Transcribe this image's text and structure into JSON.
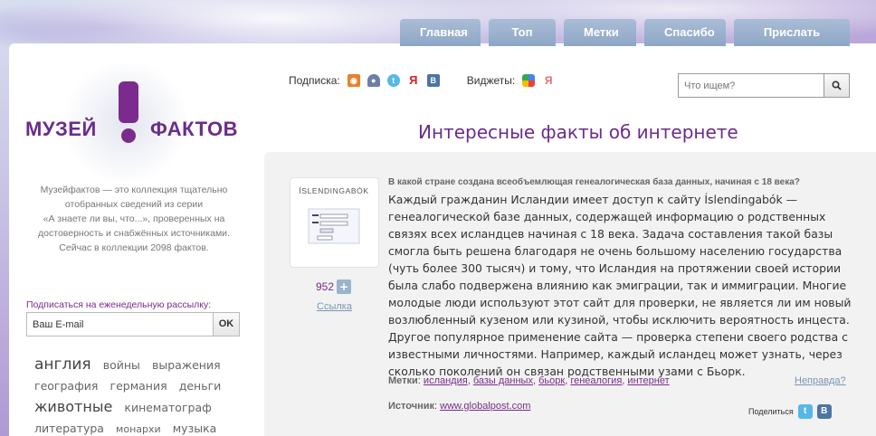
{
  "nav": {
    "items": [
      {
        "label": "Главная"
      },
      {
        "label": "Топ"
      },
      {
        "label": "Метки"
      },
      {
        "label": "Спасибо"
      },
      {
        "label": "Прислать факт"
      }
    ]
  },
  "logo": {
    "left": "МУЗЕЙ",
    "right": "ФАКТОВ"
  },
  "about": {
    "lines": [
      "Музейфактов — это коллекция тщательно",
      "отобранных сведений из серии",
      "«А знаете ли вы, что...»,  проверенных на",
      "достоверность и снабжённых источниками.",
      "Сейчас в коллекции 2098 фактов."
    ]
  },
  "newsletter": {
    "label": "Подписаться на еженедельную рассылку:",
    "value": "Ваш E-mail",
    "button": "OK"
  },
  "tag_cloud": [
    {
      "label": "англия",
      "size": "l"
    },
    {
      "label": "войны",
      "size": "m"
    },
    {
      "label": "выражения",
      "size": "m"
    },
    {
      "label": "география",
      "size": "m"
    },
    {
      "label": "германия",
      "size": "m"
    },
    {
      "label": "деньги",
      "size": "m"
    },
    {
      "label": "животные",
      "size": "xl"
    },
    {
      "label": "кинематограф",
      "size": "m"
    },
    {
      "label": "литература",
      "size": "m"
    },
    {
      "label": "монархи",
      "size": "s"
    },
    {
      "label": "музыка",
      "size": "m"
    }
  ],
  "header": {
    "subscribe_label": "Подписка:",
    "widgets_label": "Виджеты:",
    "search_placeholder": "Что ищем?",
    "page_title": "Интересные факты об интернете"
  },
  "fact": {
    "question": "В какой стране создана всеобъемлющая генеалогическая база данных, начиная с 18 века?",
    "text": "Каждый гражданин Исландии имеет доступ к сайту Íslendingabók — генеалогической базе данных, содержащей информацию о родственных связях всех исландцев начиная с 18 века. Задача составления такой базы смогла быть решена благодаря не очень большому населению государства (чуть более 300 тысяч) и тому, что Исландия на протяжении своей истории была слабо подвержена влиянию как эмиграции, так и иммиграции. Многие молодые люди используют этот сайт для проверки, не является ли им новый возлюбленный кузеном или кузиной, чтобы исключить вероятность инцеста. Другое популярное применение сайта — проверка степени своего родства с известными личностями. Например, каждый исландец может узнать, через сколько поколений он связан родственными узами с Бьорк.",
    "thumb_brand": "ÍSLENDINGABÓK",
    "votes": "952",
    "plus": "+",
    "link": "Ссылка",
    "tags_label": "Метки",
    "tags": [
      "исландия",
      "базы данных",
      "бьорк",
      "генеалогия",
      "интернет"
    ],
    "incorrect": "Неправда?",
    "source_label": "Источник",
    "source": "www.globalpost.com",
    "share_label": "Поделиться"
  },
  "colors": {
    "brand": "#6b2c8a",
    "nav": "#9ab1cf",
    "link": "#7c96b3"
  }
}
